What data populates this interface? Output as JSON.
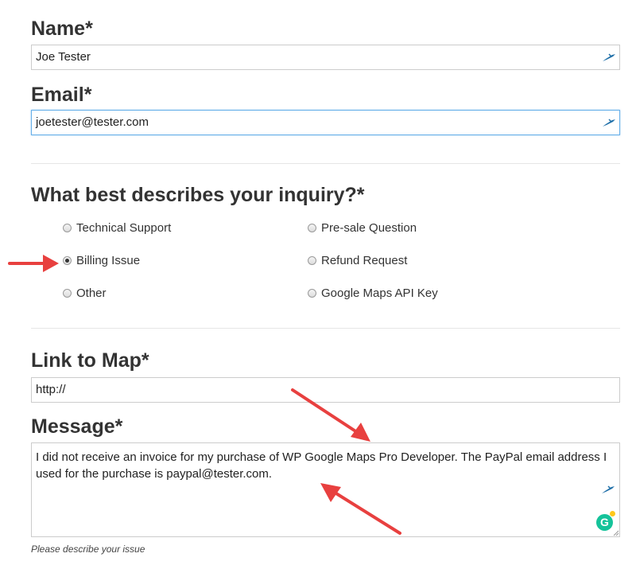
{
  "form": {
    "name": {
      "label": "Name*",
      "value": "Joe Tester",
      "icon": "autofill-pen-icon"
    },
    "email": {
      "label": "Email*",
      "value": "joetester@tester.com",
      "icon": "autofill-pen-icon"
    },
    "inquiry": {
      "label": "What best describes your inquiry?*",
      "options": [
        {
          "label": "Technical Support",
          "checked": false
        },
        {
          "label": "Pre-sale Question",
          "checked": false
        },
        {
          "label": "Billing Issue",
          "checked": true
        },
        {
          "label": "Refund Request",
          "checked": false
        },
        {
          "label": "Other",
          "checked": false
        },
        {
          "label": "Google Maps API Key",
          "checked": false
        }
      ]
    },
    "link_to_map": {
      "label": "Link to Map*",
      "value": "http://"
    },
    "message": {
      "label": "Message*",
      "value": "I did not receive an invoice for my purchase of WP Google Maps Pro Developer. The PayPal email address I used for the purchase is paypal@tester.com.",
      "help": "Please describe your issue",
      "grammarly_letter": "G"
    }
  },
  "colors": {
    "annotation_arrow": "#e8403f",
    "grammarly_green": "#15c39a",
    "focus_border": "#66afe9",
    "icon_blue": "#1f6fa8"
  }
}
